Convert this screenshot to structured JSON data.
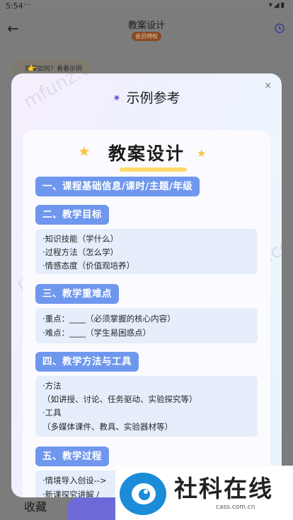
{
  "status": {
    "time": "5:54",
    "dots": "···",
    "sys": "▾◢▮"
  },
  "appbar": {
    "title": "教案设计",
    "badge": "会员特权"
  },
  "hint": {
    "label": "效果如何？看看示例"
  },
  "modal": {
    "title": "示例参考",
    "close": "×",
    "card_title": "教案设计",
    "sections": [
      {
        "header": "一、课程基础信息/课时/主题/年级",
        "lines": []
      },
      {
        "header": "二、教学目标",
        "lines": [
          "·知识技能（学什么）",
          "·过程方法（怎么学）",
          "·情感态度（价值观培养）"
        ]
      },
      {
        "header": "三、教学重难点",
        "lines": [
          "·重点：____（必须掌握的核心内容）",
          "·难点：____（学生易困惑点）"
        ]
      },
      {
        "header": "四、教学方法与工具",
        "lines": [
          "·方法",
          "（如讲授、讨论、任务驱动、实验探究等）",
          "·工具",
          "（多媒体课件、教具、实验器材等）"
        ]
      },
      {
        "header": "五、教学过程",
        "lines": [
          "·情境导入创设-->",
          "·新课探究讲解 /"
        ]
      }
    ]
  },
  "watermark": "mfunz.com",
  "bottom": {
    "collect": "收藏"
  },
  "overlay_logo": {
    "text": "社科在线",
    "url": "cass.com.cn"
  }
}
